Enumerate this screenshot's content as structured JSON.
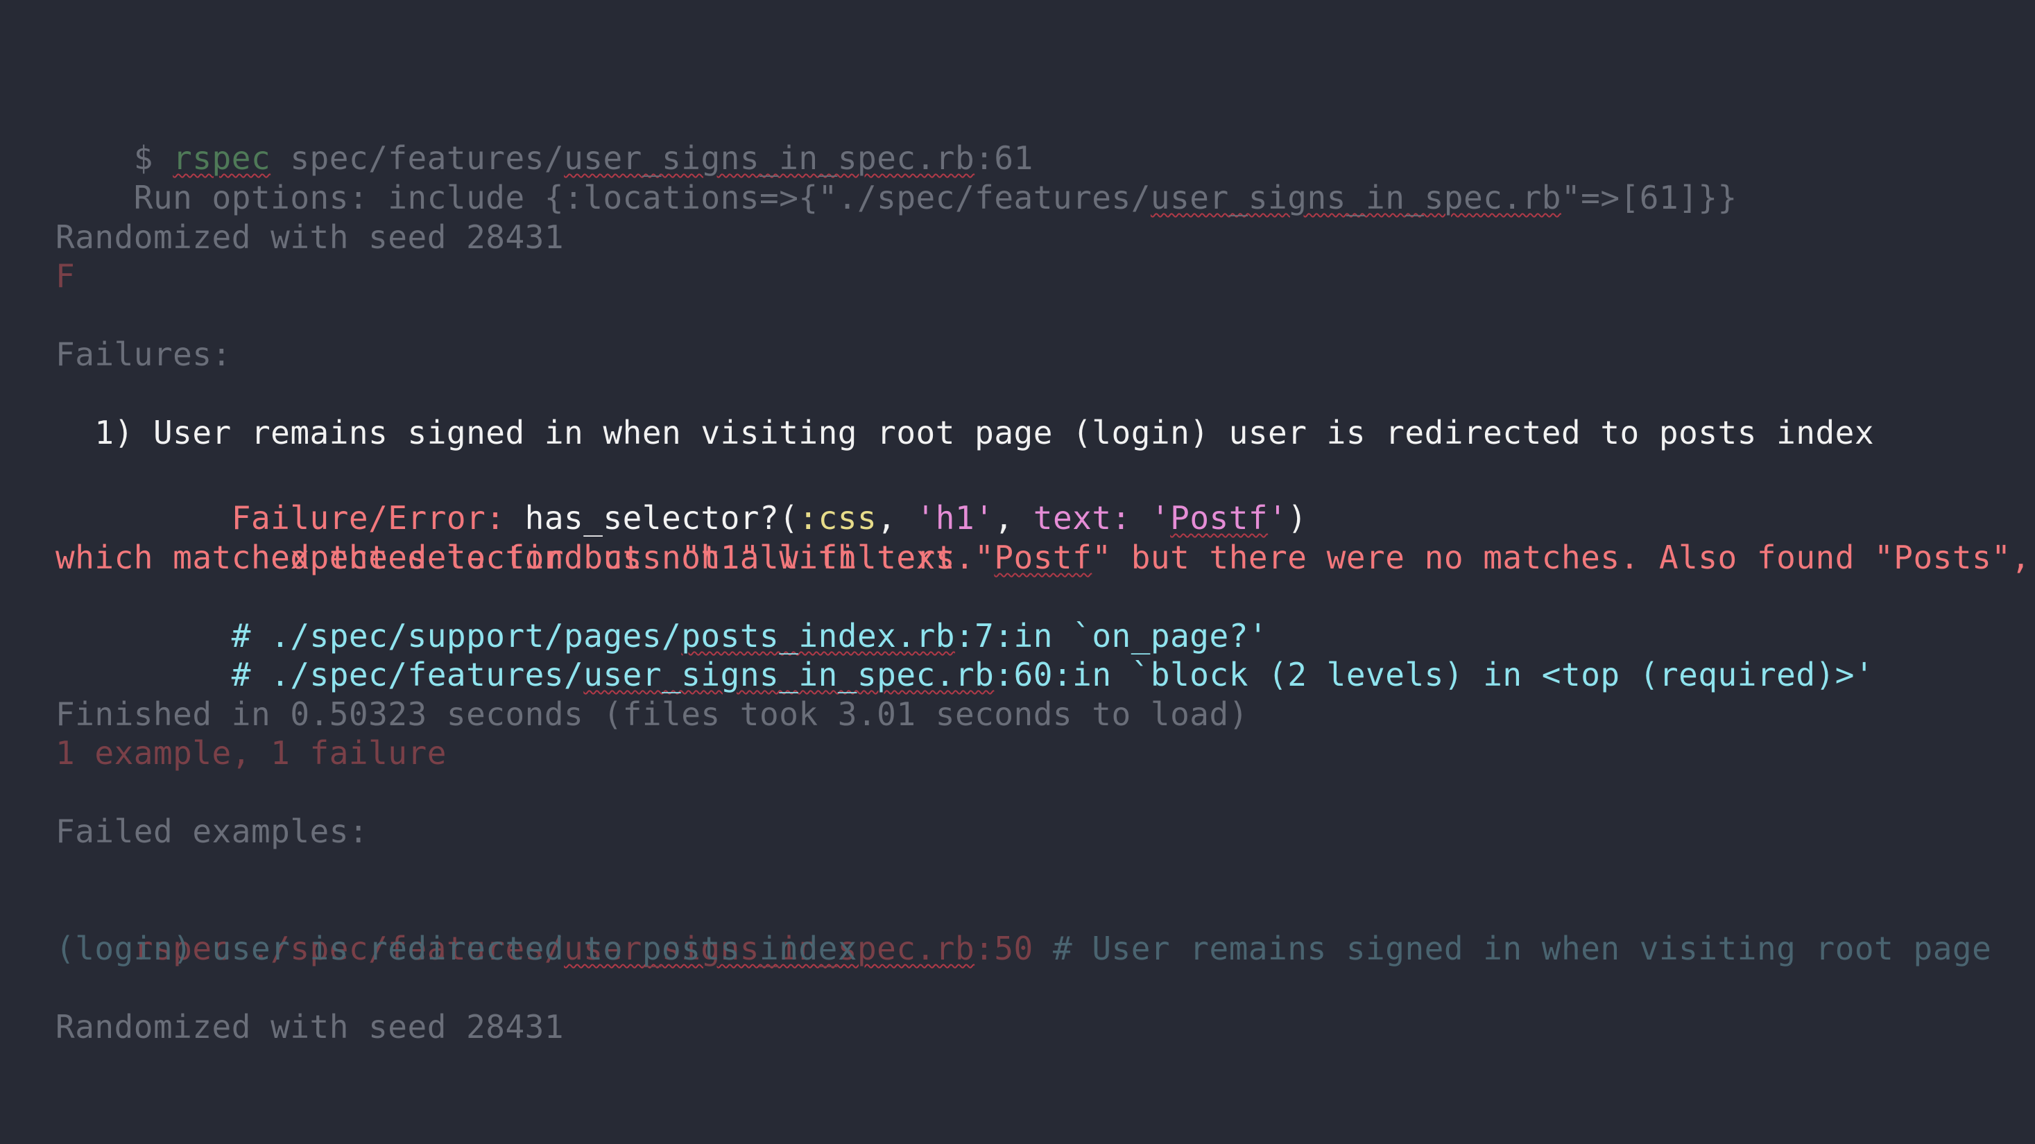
{
  "terminal": {
    "cmd_prompt": "$ ",
    "cmd_name": "rspec",
    "cmd_space": " ",
    "cmd_path_pre": "spec/features/",
    "cmd_path_file": "user_signs_in_spec.rb",
    "cmd_path_line": ":61",
    "run_options_pre": "Run options: include {:locations=>{\"./spec/features/",
    "run_options_file": "user_signs_in_spec.rb",
    "run_options_post": "\"=>[61]}}",
    "seed_line_1": "Randomized with seed 28431",
    "progress": "F",
    "failures_heading": "Failures:",
    "failure_title": "  1) User remains signed in when visiting root page (login) user is redirected to posts index",
    "failure_error_label": "     Failure/Error: ",
    "failure_error_code_1": "has_selector?(",
    "failure_error_sym": ":css",
    "failure_error_code_2": ", ",
    "failure_error_str_h1": "'h1'",
    "failure_error_code_3": ", ",
    "failure_error_key": "text:",
    "failure_error_code_4": " ",
    "failure_error_str_q1": "'",
    "failure_error_str_postf": "Postf",
    "failure_error_str_q2": "'",
    "failure_error_code_5": ")",
    "expected_pre": "       expected to find css \"h1\" with text \"",
    "expected_postf": "Postf",
    "expected_post": "\" but there were no matches. Also found \"Posts\",",
    "expected_cont": "which matched the selector but not all filters.",
    "trace_1_pre": "     # ./spec/support/pages/",
    "trace_1_file": "posts_index.rb",
    "trace_1_post": ":7:in `on_page?'",
    "trace_2_pre": "     # ./spec/features/",
    "trace_2_file": "user_signs_in_spec.rb",
    "trace_2_post": ":60:in `block (2 levels) in <top (required)>'",
    "finished_line": "Finished in 0.50323 seconds (files took 3.01 seconds to load)",
    "summary_line": "1 example, 1 failure",
    "failed_examples_heading": "Failed examples:",
    "rerun_pre": "rspec ./spec/features/",
    "rerun_file": "user_signs_in_spec.rb",
    "rerun_line": ":50",
    "rerun_comment": " # User remains signed in when visiting root page",
    "rerun_comment_cont": "(login) user is redirected to posts index",
    "seed_line_2": "Randomized with seed 28431"
  },
  "colors": {
    "background": "#272a35",
    "dim_text": "#6a6e79",
    "white_text": "#f2f2f2",
    "error_red": "#f2787c",
    "symbol_yellow": "#e7dc8a",
    "key_pink": "#e58dd6",
    "trace_cyan": "#8fe3ee"
  }
}
